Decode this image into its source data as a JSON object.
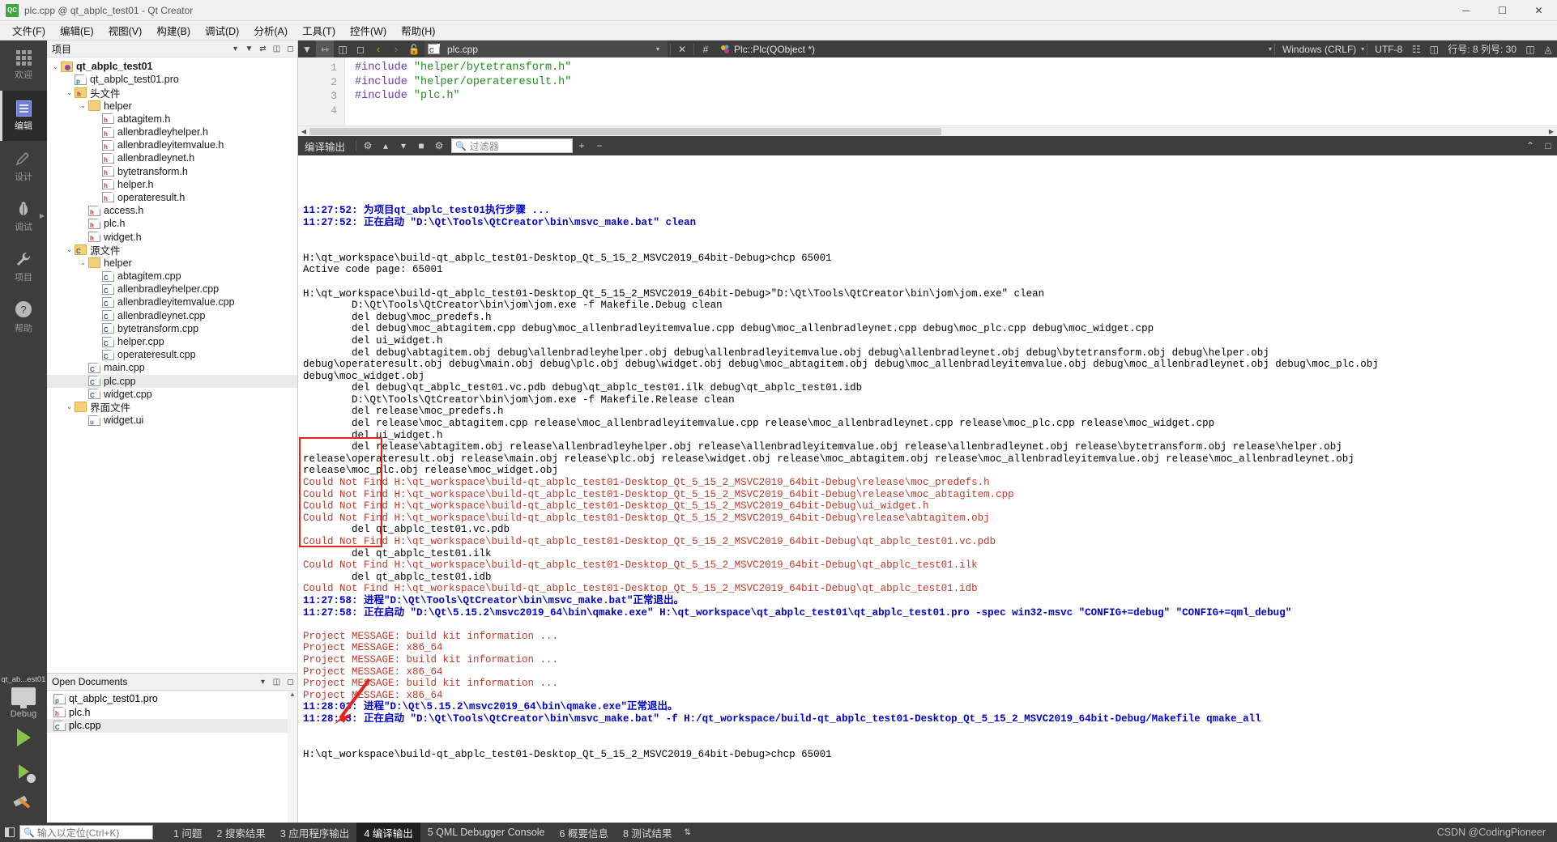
{
  "window": {
    "title": "plc.cpp @ qt_abplc_test01 - Qt Creator",
    "app_badge": "QC",
    "minimize": "─",
    "maximize": "☐",
    "close": "✕"
  },
  "menubar": [
    "文件(F)",
    "编辑(E)",
    "视图(V)",
    "构建(B)",
    "调试(D)",
    "分析(A)",
    "工具(T)",
    "控件(W)",
    "帮助(H)"
  ],
  "modebar": {
    "modes": [
      {
        "label": "欢迎",
        "icon": "grid-icon",
        "active": false
      },
      {
        "label": "编辑",
        "icon": "edit-document-icon",
        "active": true
      },
      {
        "label": "设计",
        "icon": "pencil-icon",
        "active": false
      },
      {
        "label": "调试",
        "icon": "bug-icon",
        "active": false
      },
      {
        "label": "项目",
        "icon": "wrench-icon",
        "active": false
      },
      {
        "label": "帮助",
        "icon": "help-circle-icon",
        "active": false
      }
    ],
    "kit": {
      "project": "qt_ab...est01",
      "config": "Debug"
    },
    "actions": [
      "run-button",
      "debug-button",
      "build-button"
    ]
  },
  "project_panel": {
    "header": "项目",
    "tools": [
      "filter-icon",
      "sync-icon",
      "split-icon",
      "close-icon"
    ],
    "tree": [
      {
        "depth": 0,
        "arrow": "⌄",
        "icon": "project-icon",
        "label": "qt_abplc_test01",
        "bold": true
      },
      {
        "depth": 1,
        "arrow": "",
        "icon": "pro-file-icon",
        "label": "qt_abplc_test01.pro",
        "bold": false
      },
      {
        "depth": 1,
        "arrow": "⌄",
        "icon": "folder-h-icon",
        "label": "头文件",
        "bold": false
      },
      {
        "depth": 2,
        "arrow": "⌄",
        "icon": "folder-icon",
        "label": "helper",
        "bold": false
      },
      {
        "depth": 3,
        "arrow": "",
        "icon": "h-file-icon",
        "label": "abtagitem.h",
        "bold": false
      },
      {
        "depth": 3,
        "arrow": "",
        "icon": "h-file-icon",
        "label": "allenbradleyhelper.h",
        "bold": false
      },
      {
        "depth": 3,
        "arrow": "",
        "icon": "h-file-icon",
        "label": "allenbradleyitemvalue.h",
        "bold": false
      },
      {
        "depth": 3,
        "arrow": "",
        "icon": "h-file-icon",
        "label": "allenbradleynet.h",
        "bold": false
      },
      {
        "depth": 3,
        "arrow": "",
        "icon": "h-file-icon",
        "label": "bytetransform.h",
        "bold": false
      },
      {
        "depth": 3,
        "arrow": "",
        "icon": "h-file-icon",
        "label": "helper.h",
        "bold": false
      },
      {
        "depth": 3,
        "arrow": "",
        "icon": "h-file-icon",
        "label": "operateresult.h",
        "bold": false
      },
      {
        "depth": 2,
        "arrow": "",
        "icon": "h-file-icon",
        "label": "access.h",
        "bold": false
      },
      {
        "depth": 2,
        "arrow": "",
        "icon": "h-file-icon",
        "label": "plc.h",
        "bold": false
      },
      {
        "depth": 2,
        "arrow": "",
        "icon": "h-file-icon",
        "label": "widget.h",
        "bold": false
      },
      {
        "depth": 1,
        "arrow": "⌄",
        "icon": "folder-c-icon",
        "label": "源文件",
        "bold": false
      },
      {
        "depth": 2,
        "arrow": "⌄",
        "icon": "folder-icon",
        "label": "helper",
        "bold": false
      },
      {
        "depth": 3,
        "arrow": "",
        "icon": "cpp-file-icon",
        "label": "abtagitem.cpp",
        "bold": false
      },
      {
        "depth": 3,
        "arrow": "",
        "icon": "cpp-file-icon",
        "label": "allenbradleyhelper.cpp",
        "bold": false
      },
      {
        "depth": 3,
        "arrow": "",
        "icon": "cpp-file-icon",
        "label": "allenbradleyitemvalue.cpp",
        "bold": false
      },
      {
        "depth": 3,
        "arrow": "",
        "icon": "cpp-file-icon",
        "label": "allenbradleynet.cpp",
        "bold": false
      },
      {
        "depth": 3,
        "arrow": "",
        "icon": "cpp-file-icon",
        "label": "bytetransform.cpp",
        "bold": false
      },
      {
        "depth": 3,
        "arrow": "",
        "icon": "cpp-file-icon",
        "label": "helper.cpp",
        "bold": false
      },
      {
        "depth": 3,
        "arrow": "",
        "icon": "cpp-file-icon",
        "label": "operateresult.cpp",
        "bold": false
      },
      {
        "depth": 2,
        "arrow": "",
        "icon": "cpp-file-icon",
        "label": "main.cpp",
        "bold": false
      },
      {
        "depth": 2,
        "arrow": "",
        "icon": "cpp-file-icon",
        "label": "plc.cpp",
        "bold": false,
        "selected": true
      },
      {
        "depth": 2,
        "arrow": "",
        "icon": "cpp-file-icon",
        "label": "widget.cpp",
        "bold": false
      },
      {
        "depth": 1,
        "arrow": "⌄",
        "icon": "folder-ui-icon",
        "label": "界面文件",
        "bold": false
      },
      {
        "depth": 2,
        "arrow": "",
        "icon": "ui-file-icon",
        "label": "widget.ui",
        "bold": false
      }
    ]
  },
  "open_documents": {
    "header": "Open Documents",
    "tools": [
      "dropdown-icon",
      "split-icon",
      "close-icon"
    ],
    "items": [
      {
        "label": "plc.cpp",
        "icon": "cpp-file-icon",
        "selected": true
      },
      {
        "label": "plc.h",
        "icon": "h-file-icon",
        "selected": false
      },
      {
        "label": "qt_abplc_test01.pro",
        "icon": "pro-file-icon",
        "selected": false
      }
    ]
  },
  "editor": {
    "toolbar_left_icons": [
      "filter-icon",
      "link-icon",
      "split-icon",
      "close-split-icon"
    ],
    "nav_back": "‹",
    "nav_forward": "›",
    "lock_icon": "unlock-icon",
    "file_name": "plc.cpp",
    "file_dropdown": "▾",
    "file_close": "✕",
    "symbol_hash": "#",
    "symbol_name": "Plc::Plc(QObject *)",
    "line_ending": "Windows (CRLF)",
    "encoding": "UTF-8",
    "cursor_position": "行号: 8 列号: 30",
    "line_numbers": [
      "1",
      "2",
      "3",
      "4"
    ],
    "lines": [
      {
        "directive": "#include",
        "arg": "\"helper/bytetransform.h\""
      },
      {
        "directive": "#include",
        "arg": "\"helper/operateresult.h\""
      },
      {
        "directive": "#include",
        "arg": "\"plc.h\""
      },
      {
        "directive": "",
        "arg": ""
      }
    ]
  },
  "compile_output": {
    "title": "编译输出",
    "buttons": [
      "cancel-build-icon",
      "up-icon",
      "down-icon",
      "stop-icon",
      "settings-icon"
    ],
    "filter_placeholder": "过滤器",
    "zoom_in": "+",
    "zoom_out": "−",
    "maximize": "⌃",
    "close": "□",
    "lines": [
      {
        "text": "11:27:52: 为项目qt_abplc_test01执行步骤 ...",
        "color": "blue"
      },
      {
        "text": "11:27:52: 正在启动 \"D:\\Qt\\Tools\\QtCreator\\bin\\msvc_make.bat\" clean",
        "color": "blue"
      },
      {
        "text": "",
        "color": "black"
      },
      {
        "text": "",
        "color": "black"
      },
      {
        "text": "H:\\qt_workspace\\build-qt_abplc_test01-Desktop_Qt_5_15_2_MSVC2019_64bit-Debug>chcp 65001",
        "color": "black"
      },
      {
        "text": "Active code page: 65001",
        "color": "black"
      },
      {
        "text": "",
        "color": "black"
      },
      {
        "text": "H:\\qt_workspace\\build-qt_abplc_test01-Desktop_Qt_5_15_2_MSVC2019_64bit-Debug>\"D:\\Qt\\Tools\\QtCreator\\bin\\jom\\jom.exe\" clean",
        "color": "black"
      },
      {
        "text": "        D:\\Qt\\Tools\\QtCreator\\bin\\jom\\jom.exe -f Makefile.Debug clean",
        "color": "black"
      },
      {
        "text": "        del debug\\moc_predefs.h",
        "color": "black"
      },
      {
        "text": "        del debug\\moc_abtagitem.cpp debug\\moc_allenbradleyitemvalue.cpp debug\\moc_allenbradleynet.cpp debug\\moc_plc.cpp debug\\moc_widget.cpp",
        "color": "black"
      },
      {
        "text": "        del ui_widget.h",
        "color": "black"
      },
      {
        "text": "        del debug\\abtagitem.obj debug\\allenbradleyhelper.obj debug\\allenbradleyitemvalue.obj debug\\allenbradleynet.obj debug\\bytetransform.obj debug\\helper.obj",
        "color": "black"
      },
      {
        "text": "debug\\operateresult.obj debug\\main.obj debug\\plc.obj debug\\widget.obj debug\\moc_abtagitem.obj debug\\moc_allenbradleyitemvalue.obj debug\\moc_allenbradleynet.obj debug\\moc_plc.obj",
        "color": "black"
      },
      {
        "text": "debug\\moc_widget.obj",
        "color": "black"
      },
      {
        "text": "        del debug\\qt_abplc_test01.vc.pdb debug\\qt_abplc_test01.ilk debug\\qt_abplc_test01.idb",
        "color": "black"
      },
      {
        "text": "        D:\\Qt\\Tools\\QtCreator\\bin\\jom\\jom.exe -f Makefile.Release clean",
        "color": "black"
      },
      {
        "text": "        del release\\moc_predefs.h",
        "color": "black"
      },
      {
        "text": "        del release\\moc_abtagitem.cpp release\\moc_allenbradleyitemvalue.cpp release\\moc_allenbradleynet.cpp release\\moc_plc.cpp release\\moc_widget.cpp",
        "color": "black"
      },
      {
        "text": "        del ui_widget.h",
        "color": "black"
      },
      {
        "text": "        del release\\abtagitem.obj release\\allenbradleyhelper.obj release\\allenbradleyitemvalue.obj release\\allenbradleynet.obj release\\bytetransform.obj release\\helper.obj",
        "color": "black"
      },
      {
        "text": "release\\operateresult.obj release\\main.obj release\\plc.obj release\\widget.obj release\\moc_abtagitem.obj release\\moc_allenbradleyitemvalue.obj release\\moc_allenbradleynet.obj",
        "color": "black"
      },
      {
        "text": "release\\moc_plc.obj release\\moc_widget.obj",
        "color": "black"
      },
      {
        "text": "Could Not Find H:\\qt_workspace\\build-qt_abplc_test01-Desktop_Qt_5_15_2_MSVC2019_64bit-Debug\\release\\moc_predefs.h",
        "color": "red"
      },
      {
        "text": "Could Not Find H:\\qt_workspace\\build-qt_abplc_test01-Desktop_Qt_5_15_2_MSVC2019_64bit-Debug\\release\\moc_abtagitem.cpp",
        "color": "red"
      },
      {
        "text": "Could Not Find H:\\qt_workspace\\build-qt_abplc_test01-Desktop_Qt_5_15_2_MSVC2019_64bit-Debug\\ui_widget.h",
        "color": "red"
      },
      {
        "text": "Could Not Find H:\\qt_workspace\\build-qt_abplc_test01-Desktop_Qt_5_15_2_MSVC2019_64bit-Debug\\release\\abtagitem.obj",
        "color": "red"
      },
      {
        "text": "        del qt_abplc_test01.vc.pdb",
        "color": "black"
      },
      {
        "text": "Could Not Find H:\\qt_workspace\\build-qt_abplc_test01-Desktop_Qt_5_15_2_MSVC2019_64bit-Debug\\qt_abplc_test01.vc.pdb",
        "color": "red"
      },
      {
        "text": "        del qt_abplc_test01.ilk",
        "color": "black"
      },
      {
        "text": "Could Not Find H:\\qt_workspace\\build-qt_abplc_test01-Desktop_Qt_5_15_2_MSVC2019_64bit-Debug\\qt_abplc_test01.ilk",
        "color": "red"
      },
      {
        "text": "        del qt_abplc_test01.idb",
        "color": "black"
      },
      {
        "text": "Could Not Find H:\\qt_workspace\\build-qt_abplc_test01-Desktop_Qt_5_15_2_MSVC2019_64bit-Debug\\qt_abplc_test01.idb",
        "color": "red"
      },
      {
        "text": "11:27:58: 进程\"D:\\Qt\\Tools\\QtCreator\\bin\\msvc_make.bat\"正常退出。",
        "color": "blue"
      },
      {
        "text": "11:27:58: 正在启动 \"D:\\Qt\\5.15.2\\msvc2019_64\\bin\\qmake.exe\" H:\\qt_workspace\\qt_abplc_test01\\qt_abplc_test01.pro -spec win32-msvc \"CONFIG+=debug\" \"CONFIG+=qml_debug\"",
        "color": "blue"
      },
      {
        "text": "",
        "color": "black"
      },
      {
        "text": "Project MESSAGE: build kit information ...",
        "color": "red"
      },
      {
        "text": "Project MESSAGE: x86_64",
        "color": "red"
      },
      {
        "text": "Project MESSAGE: build kit information ...",
        "color": "red"
      },
      {
        "text": "Project MESSAGE: x86_64",
        "color": "red"
      },
      {
        "text": "Project MESSAGE: build kit information ...",
        "color": "red"
      },
      {
        "text": "Project MESSAGE: x86_64",
        "color": "red"
      },
      {
        "text": "11:28:03: 进程\"D:\\Qt\\5.15.2\\msvc2019_64\\bin\\qmake.exe\"正常退出。",
        "color": "blue"
      },
      {
        "text": "11:28:03: 正在启动 \"D:\\Qt\\Tools\\QtCreator\\bin\\msvc_make.bat\" -f H:/qt_workspace/build-qt_abplc_test01-Desktop_Qt_5_15_2_MSVC2019_64bit-Debug/Makefile qmake_all",
        "color": "blue"
      },
      {
        "text": "",
        "color": "black"
      },
      {
        "text": "",
        "color": "black"
      },
      {
        "text": "H:\\qt_workspace\\build-qt_abplc_test01-Desktop_Qt_5_15_2_MSVC2019_64bit-Debug>chcp 65001",
        "color": "black"
      }
    ]
  },
  "statusbar": {
    "locator_placeholder": "输入以定位(Ctrl+K)",
    "tabs": [
      {
        "num": "1",
        "label": "问题",
        "active": false
      },
      {
        "num": "2",
        "label": "搜索结果",
        "active": false
      },
      {
        "num": "3",
        "label": "应用程序输出",
        "active": false
      },
      {
        "num": "4",
        "label": "编译输出",
        "active": true
      },
      {
        "num": "5",
        "label": "QML Debugger Console",
        "active": false
      },
      {
        "num": "6",
        "label": "概要信息",
        "active": false
      },
      {
        "num": "8",
        "label": "测试结果",
        "active": false
      }
    ],
    "updown": "⇅",
    "watermark": "CSDN @CodingPioneer"
  },
  "colors": {
    "accent_red": "#e8211b",
    "log_blue": "#0000cd",
    "log_red": "#c0392b",
    "dark_chrome": "#3d3d3d"
  }
}
